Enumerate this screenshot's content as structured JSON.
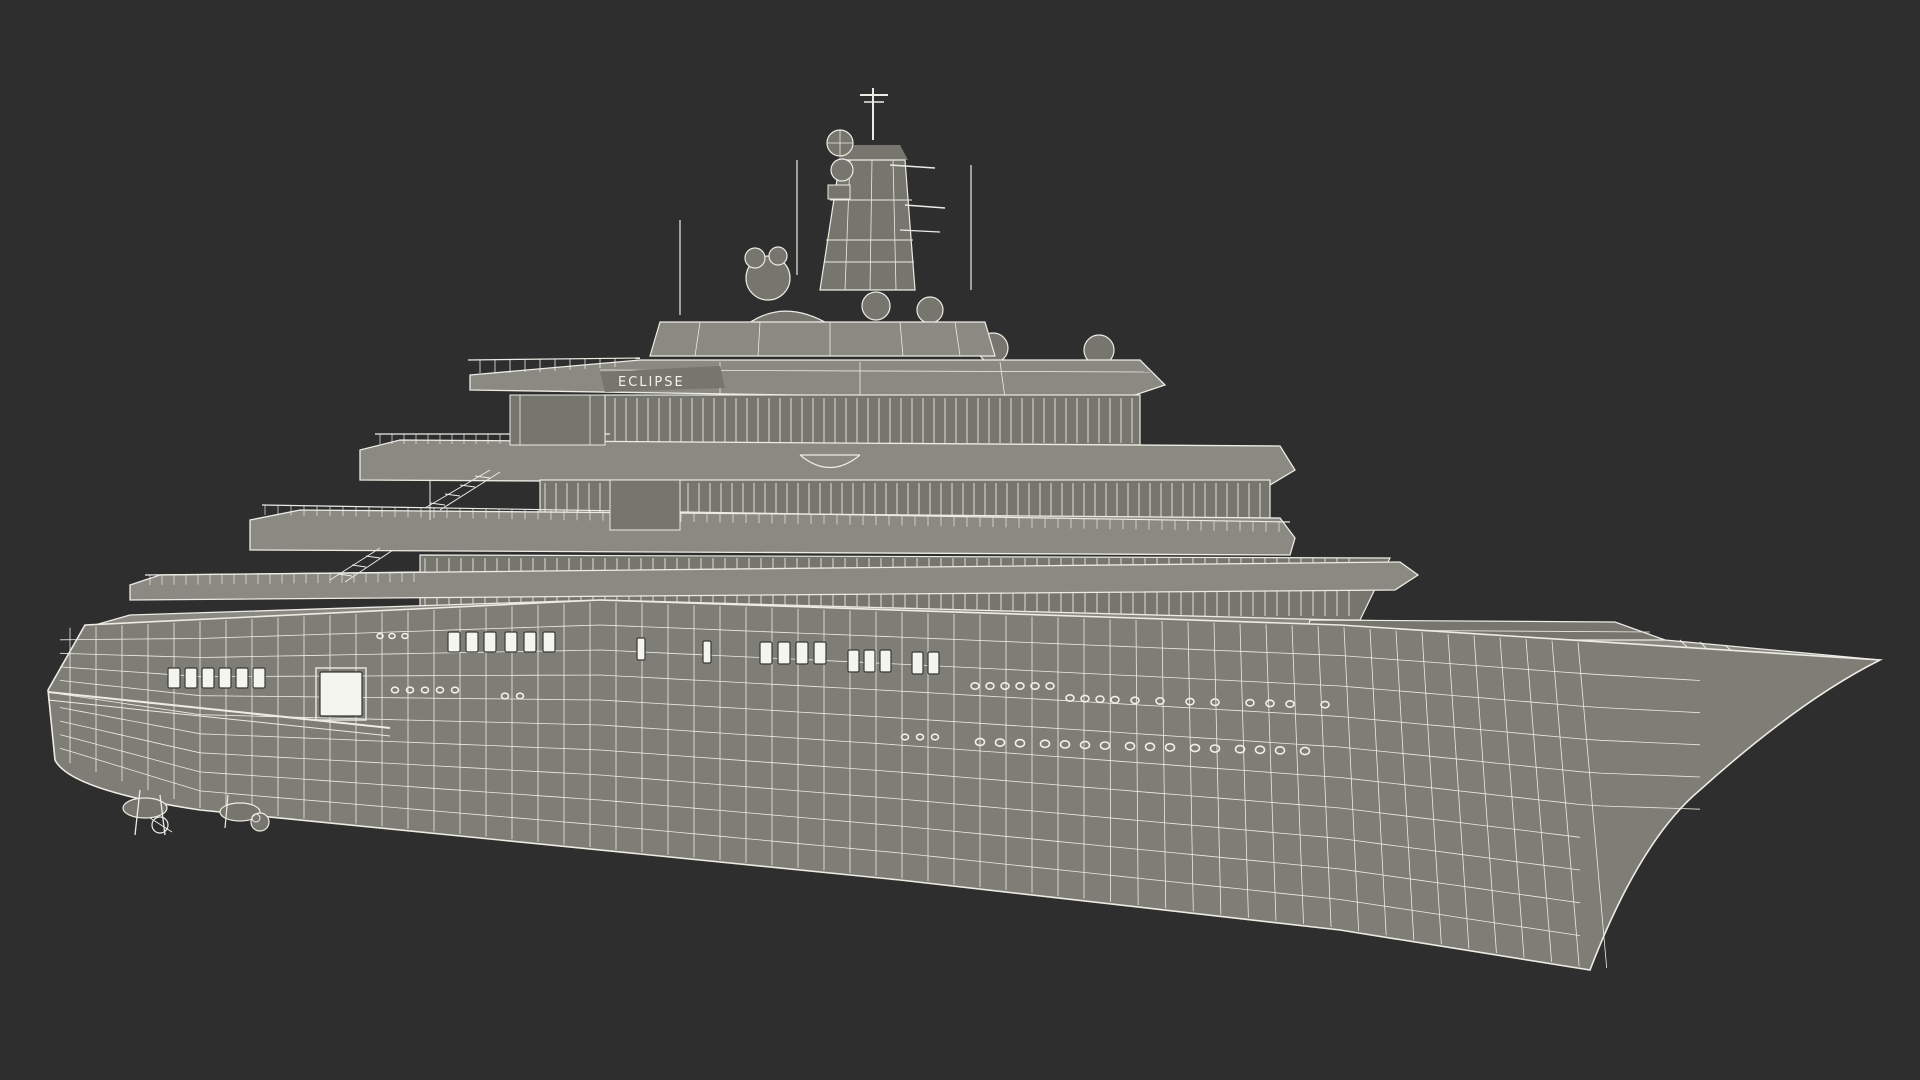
{
  "scene": {
    "background_color": "#2e2e2e",
    "wire_color": "#ecece4",
    "hull_color": "#7e7e76"
  },
  "yacht": {
    "name_plate": "ECLIPSE"
  }
}
